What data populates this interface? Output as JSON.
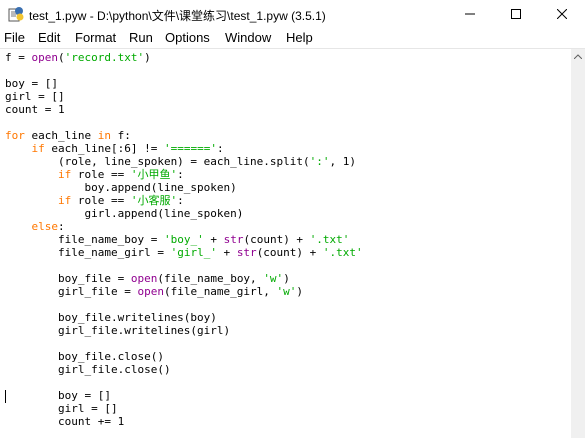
{
  "window": {
    "title": "test_1.pyw - D:\\python\\文件\\课堂练习\\test_1.pyw (3.5.1)",
    "icon": "python-idle-icon"
  },
  "menu": [
    "File",
    "Edit",
    "Format",
    "Run",
    "Options",
    "Window",
    "Help"
  ],
  "code": [
    [
      [
        "n",
        "f = "
      ],
      [
        "b",
        "open"
      ],
      [
        "n",
        "("
      ],
      [
        "s",
        "'record.txt'"
      ],
      [
        "n",
        ")"
      ]
    ],
    [],
    [
      [
        "n",
        "boy = []"
      ]
    ],
    [
      [
        "n",
        "girl = []"
      ]
    ],
    [
      [
        "n",
        "count = 1"
      ]
    ],
    [],
    [
      [
        "k",
        "for"
      ],
      [
        "n",
        " each_line "
      ],
      [
        "k",
        "in"
      ],
      [
        "n",
        " f:"
      ]
    ],
    [
      [
        "n",
        "    "
      ],
      [
        "k",
        "if"
      ],
      [
        "n",
        " each_line[:6] != "
      ],
      [
        "s",
        "'======'"
      ],
      [
        "n",
        ":"
      ]
    ],
    [
      [
        "n",
        "        (role, line_spoken) = each_line.split("
      ],
      [
        "s",
        "':'"
      ],
      [
        "n",
        ", 1)"
      ]
    ],
    [
      [
        "n",
        "        "
      ],
      [
        "k",
        "if"
      ],
      [
        "n",
        " role == "
      ],
      [
        "s",
        "'小甲鱼'"
      ],
      [
        "n",
        ":"
      ]
    ],
    [
      [
        "n",
        "            boy.append(line_spoken)"
      ]
    ],
    [
      [
        "n",
        "        "
      ],
      [
        "k",
        "if"
      ],
      [
        "n",
        " role == "
      ],
      [
        "s",
        "'小客服'"
      ],
      [
        "n",
        ":"
      ]
    ],
    [
      [
        "n",
        "            girl.append(line_spoken)"
      ]
    ],
    [
      [
        "n",
        "    "
      ],
      [
        "k",
        "else"
      ],
      [
        "n",
        ":"
      ]
    ],
    [
      [
        "n",
        "        file_name_boy = "
      ],
      [
        "s",
        "'boy_'"
      ],
      [
        "n",
        " + "
      ],
      [
        "b",
        "str"
      ],
      [
        "n",
        "(count) + "
      ],
      [
        "s",
        "'.txt'"
      ]
    ],
    [
      [
        "n",
        "        file_name_girl = "
      ],
      [
        "s",
        "'girl_'"
      ],
      [
        "n",
        " + "
      ],
      [
        "b",
        "str"
      ],
      [
        "n",
        "(count) + "
      ],
      [
        "s",
        "'.txt'"
      ]
    ],
    [],
    [
      [
        "n",
        "        boy_file = "
      ],
      [
        "b",
        "open"
      ],
      [
        "n",
        "(file_name_boy, "
      ],
      [
        "s",
        "'w'"
      ],
      [
        "n",
        ")"
      ]
    ],
    [
      [
        "n",
        "        girl_file = "
      ],
      [
        "b",
        "open"
      ],
      [
        "n",
        "(file_name_girl, "
      ],
      [
        "s",
        "'w'"
      ],
      [
        "n",
        ")"
      ]
    ],
    [],
    [
      [
        "n",
        "        boy_file.writelines(boy)"
      ]
    ],
    [
      [
        "n",
        "        girl_file.writelines(girl)"
      ]
    ],
    [],
    [
      [
        "n",
        "        boy_file.close()"
      ]
    ],
    [
      [
        "n",
        "        girl_file.close()"
      ]
    ],
    [],
    [
      [
        "n",
        "        boy = []"
      ]
    ],
    [
      [
        "n",
        "        girl = []"
      ]
    ],
    [
      [
        "n",
        "        count += 1"
      ]
    ]
  ],
  "colors": {
    "keyword": "#ff7700",
    "builtin": "#900090",
    "string": "#00aa00",
    "text": "#000000"
  },
  "icons": {
    "minimize": "minimize-icon",
    "maximize": "maximize-icon",
    "close": "close-icon",
    "scroll_up": "scroll-up-arrow-icon"
  }
}
